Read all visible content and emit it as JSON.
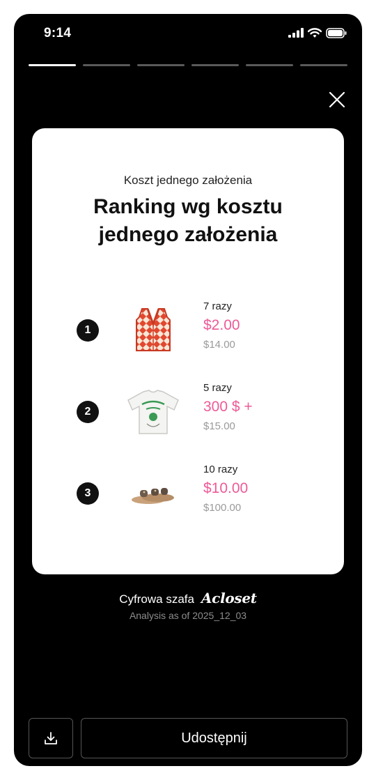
{
  "status_bar": {
    "time": "9:14"
  },
  "story": {
    "segments": 6,
    "active_index": 0
  },
  "card": {
    "subtitle": "Koszt jednego założenia",
    "title": "Ranking wg kosztu jednego założenia",
    "items": [
      {
        "rank": "1",
        "wears": "7 razy",
        "cost_per_wear": "$2.00",
        "price": "$14.00",
        "image": "orange-diamond-knit-vest"
      },
      {
        "rank": "2",
        "wears": "5 razy",
        "cost_per_wear": "300 $ +",
        "price": "$15.00",
        "image": "white-retriever-club-tshirt"
      },
      {
        "rank": "3",
        "wears": "10 razy",
        "cost_per_wear": "$10.00",
        "price": "$100.00",
        "image": "brown-strap-sandals"
      }
    ]
  },
  "footer": {
    "brand_prefix": "Cyfrowa szafa",
    "brand_logo": "Acloset",
    "analysis_date": "Analysis as of 2025_12_03"
  },
  "actions": {
    "share_label": "Udostępnij"
  },
  "colors": {
    "accent": "#ee5a97",
    "background": "#000000",
    "card": "#ffffff"
  }
}
